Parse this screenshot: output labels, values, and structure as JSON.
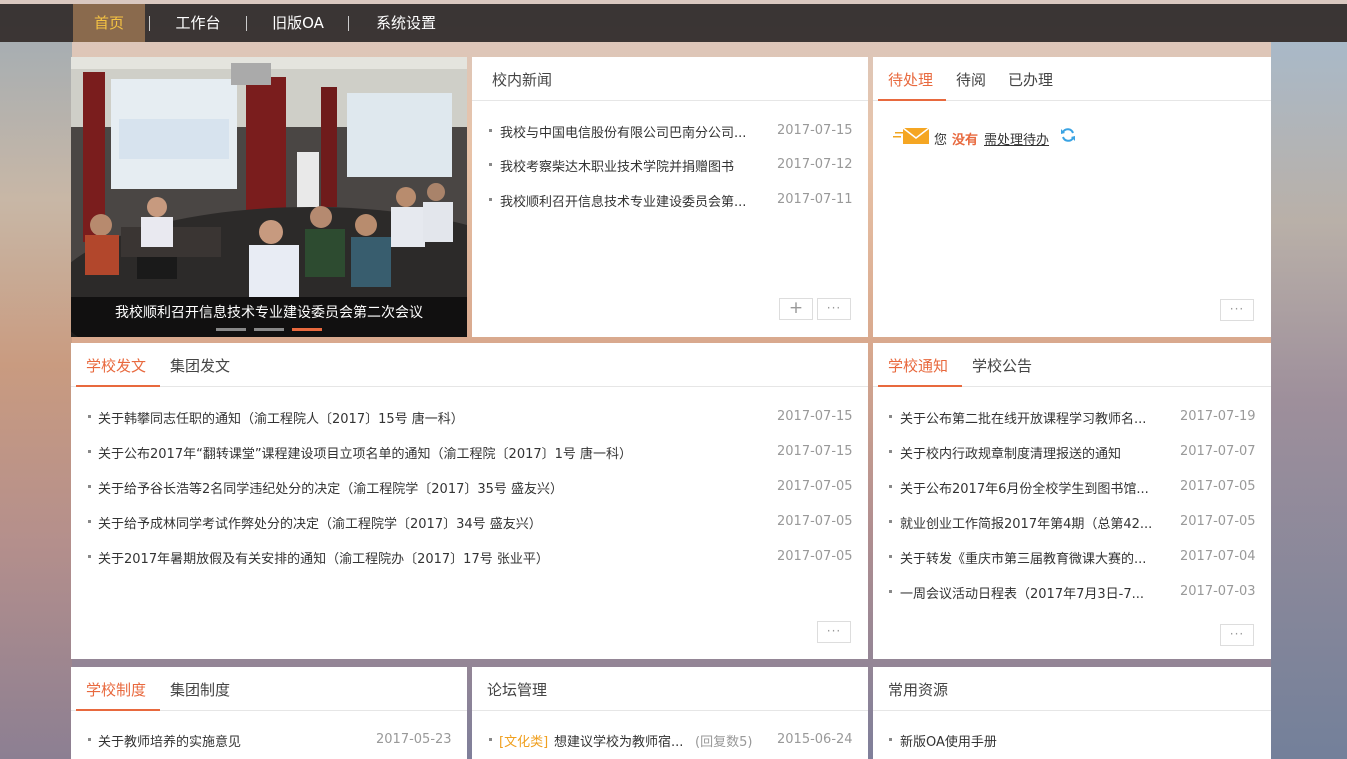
{
  "nav": {
    "items": [
      {
        "label": "首页",
        "active": true
      },
      {
        "label": "工作台",
        "active": false
      },
      {
        "label": "旧版OA",
        "active": false
      },
      {
        "label": "系统设置",
        "active": false
      }
    ]
  },
  "carousel": {
    "caption": "我校顺利召开信息技术专业建设委员会第二次会议",
    "slide_count": 3,
    "active_slide": 3
  },
  "news": {
    "title": "校内新闻",
    "items": [
      {
        "text": "我校与中国电信股份有限公司巴南分公司...",
        "date": "2017-07-15"
      },
      {
        "text": "我校考察柴达木职业技术学院并捐赠图书",
        "date": "2017-07-12"
      },
      {
        "text": "我校顺利召开信息技术专业建设委员会第...",
        "date": "2017-07-11"
      }
    ],
    "plus_label": "+",
    "more_label": "···"
  },
  "todo": {
    "tabs": [
      {
        "label": "待处理",
        "active": true
      },
      {
        "label": "待阅",
        "active": false
      },
      {
        "label": "已办理",
        "active": false
      }
    ],
    "message_prefix": "您",
    "message_status": "没有",
    "message_link": "需处理待办",
    "more_label": "···"
  },
  "documents": {
    "tabs": [
      {
        "label": "学校发文",
        "active": true
      },
      {
        "label": "集团发文",
        "active": false
      }
    ],
    "items": [
      {
        "text": "关于韩攀同志任职的通知（渝工程院人〔2017〕15号 唐一科）",
        "date": "2017-07-15"
      },
      {
        "text": "关于公布2017年“翻转课堂”课程建设项目立项名单的通知（渝工程院〔2017〕1号 唐一科）",
        "date": "2017-07-15"
      },
      {
        "text": "关于给予谷长浩等2名同学违纪处分的决定（渝工程院学〔2017〕35号 盛友兴）",
        "date": "2017-07-05"
      },
      {
        "text": "关于给予成林同学考试作弊处分的决定（渝工程院学〔2017〕34号 盛友兴）",
        "date": "2017-07-05"
      },
      {
        "text": "关于2017年暑期放假及有关安排的通知（渝工程院办〔2017〕17号 张业平）",
        "date": "2017-07-05"
      }
    ],
    "more_label": "···"
  },
  "notices": {
    "tabs": [
      {
        "label": "学校通知",
        "active": true
      },
      {
        "label": "学校公告",
        "active": false
      }
    ],
    "items": [
      {
        "text": "关于公布第二批在线开放课程学习教师名...",
        "date": "2017-07-19"
      },
      {
        "text": "关于校内行政规章制度清理报送的通知",
        "date": "2017-07-07"
      },
      {
        "text": "关于公布2017年6月份全校学生到图书馆...",
        "date": "2017-07-05"
      },
      {
        "text": "就业创业工作简报2017年第4期（总第42...",
        "date": "2017-07-05"
      },
      {
        "text": "关于转发《重庆市第三届教育微课大赛的...",
        "date": "2017-07-04"
      },
      {
        "text": "一周会议活动日程表（2017年7月3日-7...",
        "date": "2017-07-03"
      }
    ],
    "more_label": "···"
  },
  "regulations": {
    "tabs": [
      {
        "label": "学校制度",
        "active": true
      },
      {
        "label": "集团制度",
        "active": false
      }
    ],
    "items": [
      {
        "text": "关于教师培养的实施意见",
        "date": "2017-05-23"
      }
    ]
  },
  "forum": {
    "title": "论坛管理",
    "items": [
      {
        "category": "[文化类]",
        "text": "想建议学校为教师宿...",
        "replies": "(回复数5)",
        "date": "2015-06-24"
      }
    ]
  },
  "resources": {
    "title": "常用资源",
    "items": [
      {
        "text": "新版OA使用手册"
      }
    ]
  },
  "colors": {
    "accent": "#e8693e",
    "nav_active_bg": "#8a6a4d",
    "nav_active_text": "#f5c342",
    "date": "#999999"
  }
}
